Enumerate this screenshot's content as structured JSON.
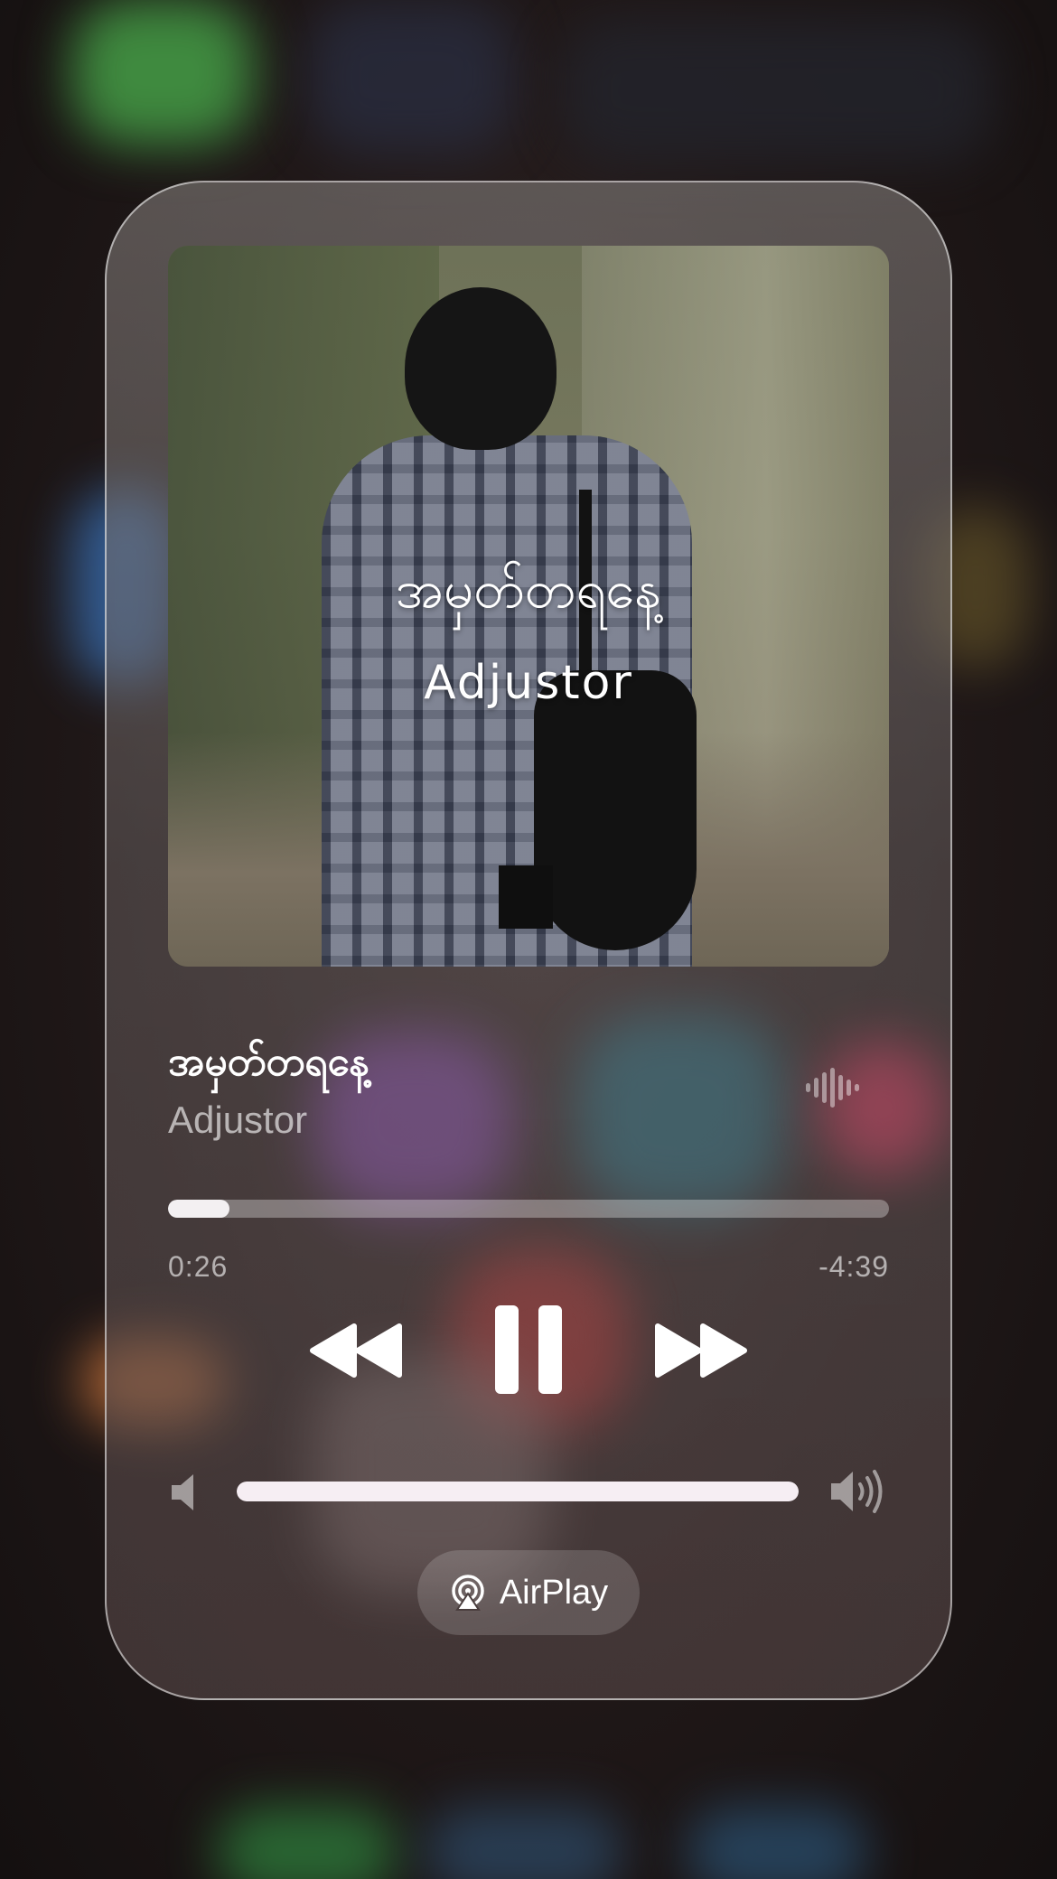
{
  "player": {
    "album_art": {
      "title_text": "အမှတ်တရနေ့",
      "artist_text": "Adjustor"
    },
    "song_title": "အမှတ်တရနေ့",
    "artist": "Adjustor",
    "progress": {
      "elapsed": "0:26",
      "remaining": "-4:39",
      "fraction": 0.085
    },
    "controls": [
      "rewind-icon",
      "pause-icon",
      "fast-forward-icon"
    ],
    "volume": {
      "level": 1.0,
      "low_icon": "speaker-low-icon",
      "high_icon": "speaker-high-icon"
    },
    "airplay": {
      "label": "AirPlay",
      "icon": "airplay-icon"
    },
    "waveform_icon": "waveform-icon"
  },
  "colors": {
    "accent": "#ffffff",
    "track": "#f3f0f2"
  }
}
